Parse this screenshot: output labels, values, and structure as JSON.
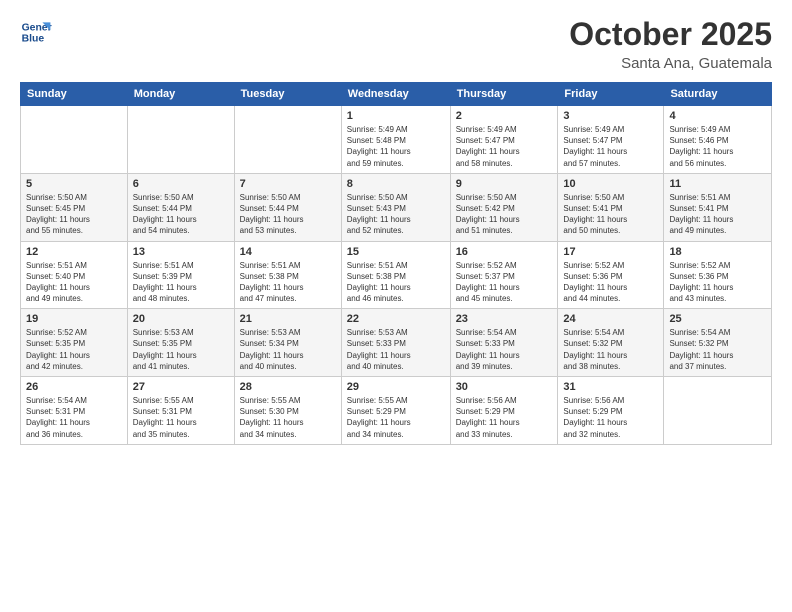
{
  "logo": {
    "line1": "General",
    "line2": "Blue"
  },
  "title": "October 2025",
  "location": "Santa Ana, Guatemala",
  "days_header": [
    "Sunday",
    "Monday",
    "Tuesday",
    "Wednesday",
    "Thursday",
    "Friday",
    "Saturday"
  ],
  "weeks": [
    [
      {
        "day": "",
        "info": ""
      },
      {
        "day": "",
        "info": ""
      },
      {
        "day": "",
        "info": ""
      },
      {
        "day": "1",
        "info": "Sunrise: 5:49 AM\nSunset: 5:48 PM\nDaylight: 11 hours\nand 59 minutes."
      },
      {
        "day": "2",
        "info": "Sunrise: 5:49 AM\nSunset: 5:47 PM\nDaylight: 11 hours\nand 58 minutes."
      },
      {
        "day": "3",
        "info": "Sunrise: 5:49 AM\nSunset: 5:47 PM\nDaylight: 11 hours\nand 57 minutes."
      },
      {
        "day": "4",
        "info": "Sunrise: 5:49 AM\nSunset: 5:46 PM\nDaylight: 11 hours\nand 56 minutes."
      }
    ],
    [
      {
        "day": "5",
        "info": "Sunrise: 5:50 AM\nSunset: 5:45 PM\nDaylight: 11 hours\nand 55 minutes."
      },
      {
        "day": "6",
        "info": "Sunrise: 5:50 AM\nSunset: 5:44 PM\nDaylight: 11 hours\nand 54 minutes."
      },
      {
        "day": "7",
        "info": "Sunrise: 5:50 AM\nSunset: 5:44 PM\nDaylight: 11 hours\nand 53 minutes."
      },
      {
        "day": "8",
        "info": "Sunrise: 5:50 AM\nSunset: 5:43 PM\nDaylight: 11 hours\nand 52 minutes."
      },
      {
        "day": "9",
        "info": "Sunrise: 5:50 AM\nSunset: 5:42 PM\nDaylight: 11 hours\nand 51 minutes."
      },
      {
        "day": "10",
        "info": "Sunrise: 5:50 AM\nSunset: 5:41 PM\nDaylight: 11 hours\nand 50 minutes."
      },
      {
        "day": "11",
        "info": "Sunrise: 5:51 AM\nSunset: 5:41 PM\nDaylight: 11 hours\nand 49 minutes."
      }
    ],
    [
      {
        "day": "12",
        "info": "Sunrise: 5:51 AM\nSunset: 5:40 PM\nDaylight: 11 hours\nand 49 minutes."
      },
      {
        "day": "13",
        "info": "Sunrise: 5:51 AM\nSunset: 5:39 PM\nDaylight: 11 hours\nand 48 minutes."
      },
      {
        "day": "14",
        "info": "Sunrise: 5:51 AM\nSunset: 5:38 PM\nDaylight: 11 hours\nand 47 minutes."
      },
      {
        "day": "15",
        "info": "Sunrise: 5:51 AM\nSunset: 5:38 PM\nDaylight: 11 hours\nand 46 minutes."
      },
      {
        "day": "16",
        "info": "Sunrise: 5:52 AM\nSunset: 5:37 PM\nDaylight: 11 hours\nand 45 minutes."
      },
      {
        "day": "17",
        "info": "Sunrise: 5:52 AM\nSunset: 5:36 PM\nDaylight: 11 hours\nand 44 minutes."
      },
      {
        "day": "18",
        "info": "Sunrise: 5:52 AM\nSunset: 5:36 PM\nDaylight: 11 hours\nand 43 minutes."
      }
    ],
    [
      {
        "day": "19",
        "info": "Sunrise: 5:52 AM\nSunset: 5:35 PM\nDaylight: 11 hours\nand 42 minutes."
      },
      {
        "day": "20",
        "info": "Sunrise: 5:53 AM\nSunset: 5:35 PM\nDaylight: 11 hours\nand 41 minutes."
      },
      {
        "day": "21",
        "info": "Sunrise: 5:53 AM\nSunset: 5:34 PM\nDaylight: 11 hours\nand 40 minutes."
      },
      {
        "day": "22",
        "info": "Sunrise: 5:53 AM\nSunset: 5:33 PM\nDaylight: 11 hours\nand 40 minutes."
      },
      {
        "day": "23",
        "info": "Sunrise: 5:54 AM\nSunset: 5:33 PM\nDaylight: 11 hours\nand 39 minutes."
      },
      {
        "day": "24",
        "info": "Sunrise: 5:54 AM\nSunset: 5:32 PM\nDaylight: 11 hours\nand 38 minutes."
      },
      {
        "day": "25",
        "info": "Sunrise: 5:54 AM\nSunset: 5:32 PM\nDaylight: 11 hours\nand 37 minutes."
      }
    ],
    [
      {
        "day": "26",
        "info": "Sunrise: 5:54 AM\nSunset: 5:31 PM\nDaylight: 11 hours\nand 36 minutes."
      },
      {
        "day": "27",
        "info": "Sunrise: 5:55 AM\nSunset: 5:31 PM\nDaylight: 11 hours\nand 35 minutes."
      },
      {
        "day": "28",
        "info": "Sunrise: 5:55 AM\nSunset: 5:30 PM\nDaylight: 11 hours\nand 34 minutes."
      },
      {
        "day": "29",
        "info": "Sunrise: 5:55 AM\nSunset: 5:29 PM\nDaylight: 11 hours\nand 34 minutes."
      },
      {
        "day": "30",
        "info": "Sunrise: 5:56 AM\nSunset: 5:29 PM\nDaylight: 11 hours\nand 33 minutes."
      },
      {
        "day": "31",
        "info": "Sunrise: 5:56 AM\nSunset: 5:29 PM\nDaylight: 11 hours\nand 32 minutes."
      },
      {
        "day": "",
        "info": ""
      }
    ]
  ]
}
